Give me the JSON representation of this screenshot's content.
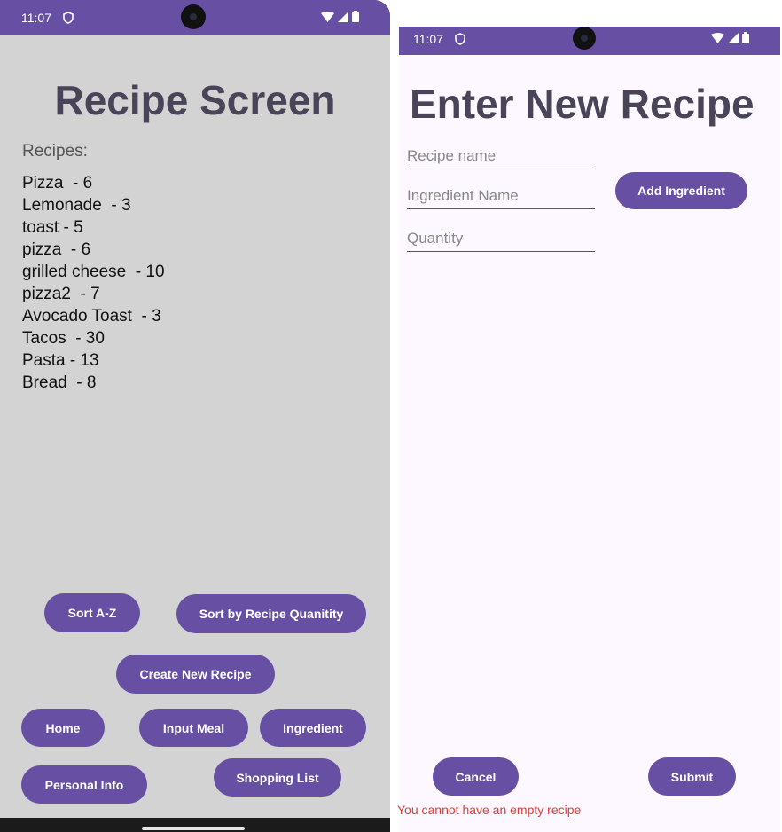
{
  "colors": {
    "accent": "#6750a4",
    "left_background": "#d3d3d3",
    "right_background": "#fdf7ff",
    "title_text": "#4a4458",
    "error": "#e53935"
  },
  "left_phone": {
    "status_bar": {
      "time": "11:07",
      "icons": [
        "shield-icon",
        "wifi-icon",
        "signal-icon",
        "battery-icon"
      ]
    },
    "title": "Recipe Screen",
    "recipes_label": "Recipes:",
    "recipes": [
      "Pizza  - 6",
      "Lemonade  - 3",
      "toast - 5",
      "pizza  - 6",
      "grilled cheese  - 10",
      "pizza2  - 7",
      "Avocado Toast  - 3",
      "Tacos  - 30",
      "Pasta - 13",
      "Bread  - 8"
    ],
    "buttons": {
      "sort_az": "Sort A-Z",
      "sort_quantity": "Sort by Recipe Quanitity",
      "create_recipe": "Create New Recipe",
      "home": "Home",
      "input_meal": "Input Meal",
      "ingredient": "Ingredient",
      "personal_info": "Personal Info",
      "shopping_list": "Shopping List"
    }
  },
  "right_phone": {
    "status_bar": {
      "time": "11:07",
      "icons": [
        "shield-icon",
        "wifi-icon",
        "signal-icon",
        "battery-icon"
      ]
    },
    "title": "Enter New Recipe",
    "fields": {
      "recipe_name": {
        "placeholder": "Recipe name",
        "value": ""
      },
      "ingredient_name": {
        "placeholder": "Ingredient Name",
        "value": ""
      },
      "quantity": {
        "placeholder": "Quantity",
        "value": ""
      }
    },
    "buttons": {
      "add_ingredient": "Add Ingredient",
      "cancel": "Cancel",
      "submit": "Submit"
    },
    "error_message": "You cannot have an empty recipe"
  }
}
